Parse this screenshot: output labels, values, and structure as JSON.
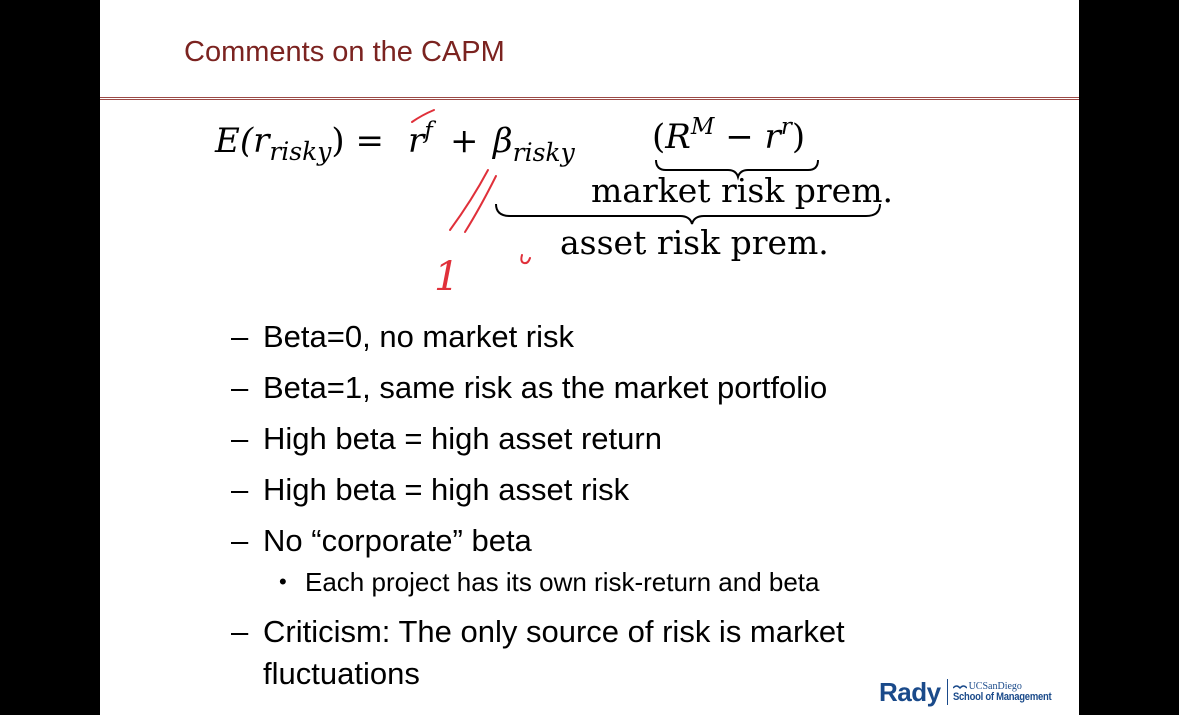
{
  "title": "Comments on the CAPM",
  "formula": {
    "lhs": "E(r",
    "lhs_sub": "risky",
    "lhs_close": ") = ",
    "rf_base": "r",
    "rf_sup": "f",
    "plus": " + ",
    "beta": "β",
    "beta_sub": "risky",
    "paren_open": "(",
    "rm_base": "R",
    "rm_sup": "M",
    "minus": " − ",
    "rr_base": "r",
    "rr_sup": "r",
    "paren_close": ")",
    "market_label": "market risk prem.",
    "asset_label": "asset risk prem."
  },
  "annotations": {
    "handwritten": "1",
    "color": "#e0303a"
  },
  "bullets": [
    {
      "dash": "–",
      "text": "Beta=0, no market risk"
    },
    {
      "dash": "–",
      "text": "Beta=1, same risk as the market portfolio"
    },
    {
      "dash": "–",
      "text": "High beta = high asset return"
    },
    {
      "dash": "–",
      "text": "High beta = high asset risk"
    },
    {
      "dash": "–",
      "text": "No “corporate” beta"
    }
  ],
  "sub_bullet": {
    "dot": "•",
    "text": "Each project has its own risk-return and beta"
  },
  "last_bullet": {
    "dash": "–",
    "line1": "Criticism: The only source of risk is market",
    "line2": "fluctuations"
  },
  "logo": {
    "name": "Rady",
    "org": "UCSanDiego",
    "school": "School of Management",
    "color": "#1a4a8a"
  },
  "colors": {
    "title": "#7b2320",
    "rule": "#9b4a46",
    "background": "#ffffff",
    "frame": "#000000"
  }
}
